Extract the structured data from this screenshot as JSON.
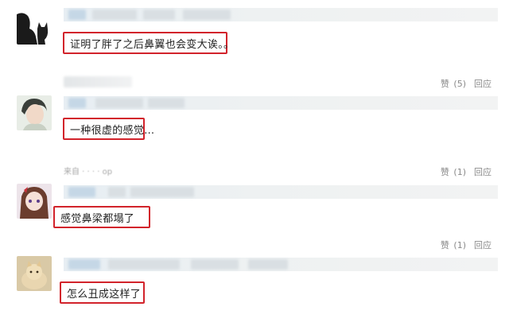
{
  "comments": [
    {
      "text": "证明了胖了之后鼻翼也会变大诶。。",
      "avatar": "silhouette-cat-avatar"
    },
    {
      "text": "一种很虚的感觉…",
      "avatar": "person-portrait-avatar",
      "like_label": "赞",
      "like_count": "(5)",
      "reply_label": "回应"
    },
    {
      "text": "感觉鼻梁都塌了",
      "avatar": "anime-girl-avatar",
      "meta": "来自 · · · · op",
      "like_label": "赞",
      "like_count": "(1)",
      "reply_label": "回应"
    },
    {
      "text": "怎么丑成这样了",
      "avatar": "cat-photo-avatar",
      "like_label": "赞",
      "like_count": "(1)",
      "reply_label": "回应"
    }
  ],
  "colors": {
    "highlight_border": "#d2232b",
    "action_text": "#8a8a8a"
  }
}
